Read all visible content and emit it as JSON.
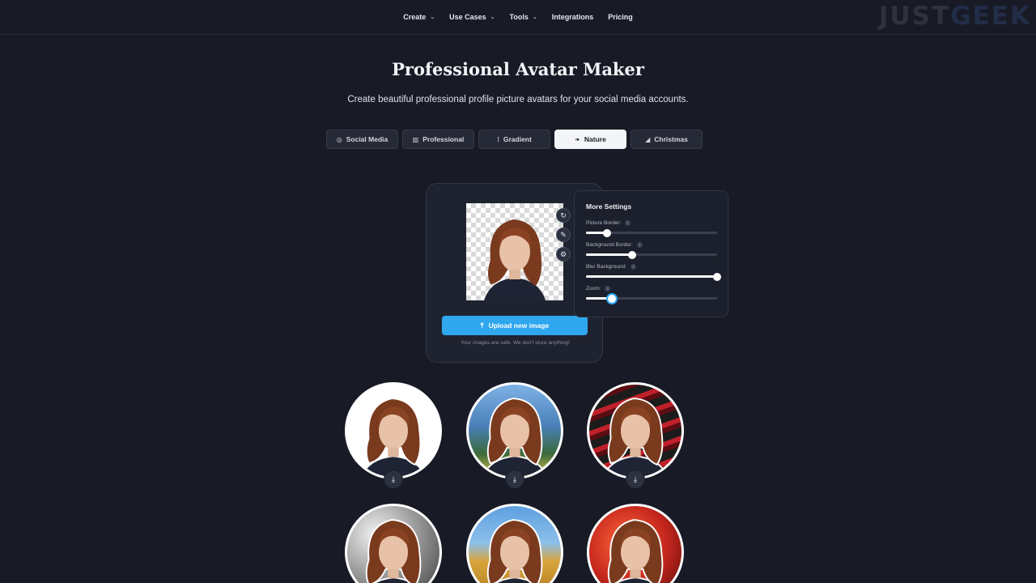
{
  "nav": {
    "items": [
      {
        "label": "Create",
        "dropdown": true
      },
      {
        "label": "Use Cases",
        "dropdown": true
      },
      {
        "label": "Tools",
        "dropdown": true
      },
      {
        "label": "Integrations",
        "dropdown": false
      },
      {
        "label": "Pricing",
        "dropdown": false
      }
    ]
  },
  "watermark": {
    "part1": "JUST",
    "part2": "GEEK"
  },
  "page": {
    "title": "Professional Avatar Maker",
    "subtitle": "Create beautiful professional profile picture avatars for your social media accounts."
  },
  "tabs": [
    {
      "label": "Social Media",
      "icon": "social-icon",
      "glyph": "◎",
      "active": false
    },
    {
      "label": "Professional",
      "icon": "briefcase-icon",
      "glyph": "▥",
      "active": false
    },
    {
      "label": "Gradient",
      "icon": "gradient-icon",
      "glyph": "⁞",
      "active": false
    },
    {
      "label": "Nature",
      "icon": "leaf-icon",
      "glyph": "❧",
      "active": true
    },
    {
      "label": "Christmas",
      "icon": "tree-icon",
      "glyph": "◢",
      "active": false
    }
  ],
  "editor": {
    "upload_label": "Upload new image",
    "safe_note": "Your images are safe. We don't store anything!"
  },
  "settings": {
    "title": "More Settings",
    "sliders": [
      {
        "label": "Picture Border:",
        "value_pct": 16
      },
      {
        "label": "Background Border:",
        "value_pct": 35
      },
      {
        "label": "Blur Background:",
        "value_pct": 100
      },
      {
        "label": "Zoom:",
        "value_pct": 20
      }
    ]
  },
  "avatars": [
    {
      "style": "white",
      "bg": "#ffffff"
    },
    {
      "style": "mountain",
      "bg": "#5a8fc9"
    },
    {
      "style": "red-lines",
      "bg": "#b8202a"
    },
    {
      "style": "grey-smoke",
      "bg": "#b5b5b5"
    },
    {
      "style": "field",
      "bg": "#d8a43a"
    },
    {
      "style": "red-swirl",
      "bg": "#c8281e"
    }
  ],
  "colors": {
    "background": "#181b26",
    "accent": "#2ea7ee",
    "active_tab": "#f4f5f8"
  }
}
